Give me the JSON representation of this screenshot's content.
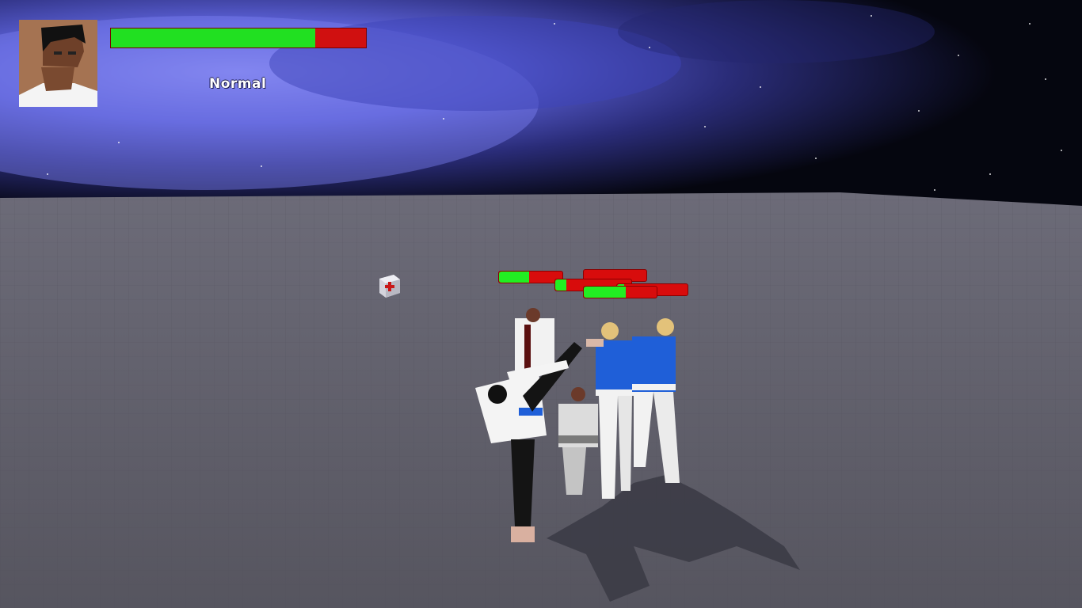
{
  "hud": {
    "difficulty": "Normal",
    "player_health": 0.8
  },
  "enemies": [
    {
      "id": "enemy-1",
      "health": 0.48
    },
    {
      "id": "enemy-2",
      "health": 0.0
    },
    {
      "id": "enemy-3",
      "health": 0.15
    },
    {
      "id": "enemy-4",
      "health": 0.1
    },
    {
      "id": "enemy-5",
      "health": 0.58
    }
  ],
  "pickups": [
    {
      "type": "health-pack",
      "icon": "red-cross-icon"
    }
  ],
  "colors": {
    "health_green": "#22ee22",
    "health_red": "#d80c0c",
    "sky": "#4b53c8",
    "floor": "#5f5f6c"
  }
}
